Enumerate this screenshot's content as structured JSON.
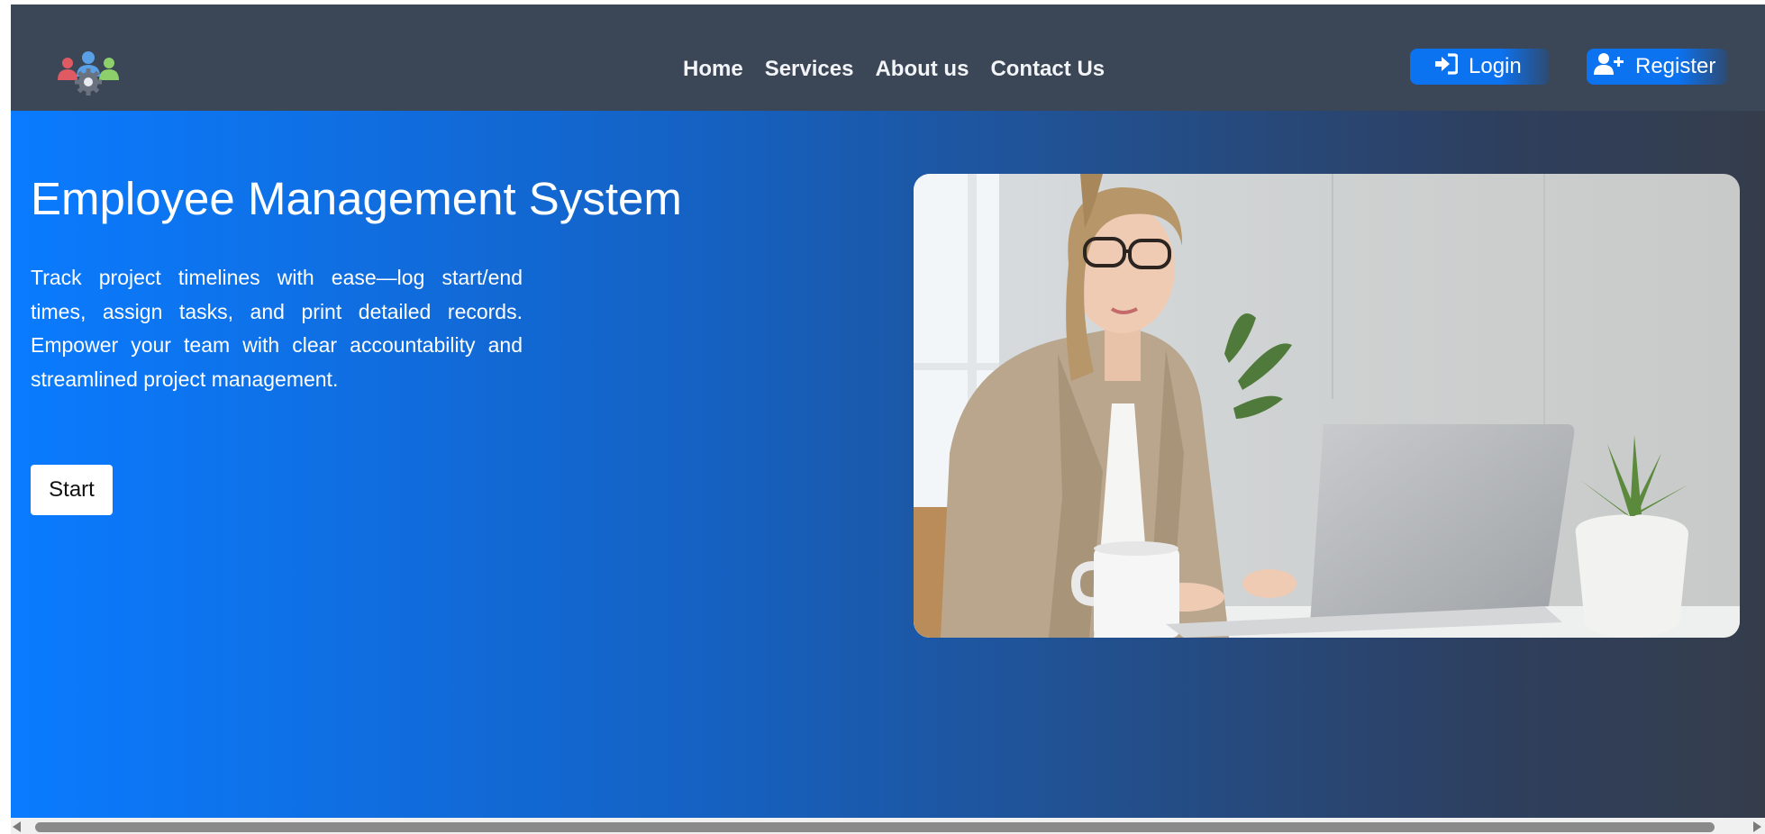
{
  "navbar": {
    "logo_icon": "team-gear-icon",
    "links": [
      {
        "label": "Home"
      },
      {
        "label": "Services"
      },
      {
        "label": "About us"
      },
      {
        "label": "Contact Us"
      }
    ],
    "login": {
      "label": "Login",
      "icon": "sign-in-icon"
    },
    "register": {
      "label": "Register",
      "icon": "user-plus-icon"
    }
  },
  "hero": {
    "title": "Employee Management System",
    "description": "Track project timelines with ease—log start/end times, assign tasks, and print detailed records. Empower your team with clear accountability and streamlined project management.",
    "start_label": "Start",
    "image_subject": "woman-working-on-laptop-photo"
  },
  "colors": {
    "navbar_bg": "#3b4656",
    "accent_blue": "#0a7bff",
    "hero_gradient_end": "#353d4b"
  }
}
